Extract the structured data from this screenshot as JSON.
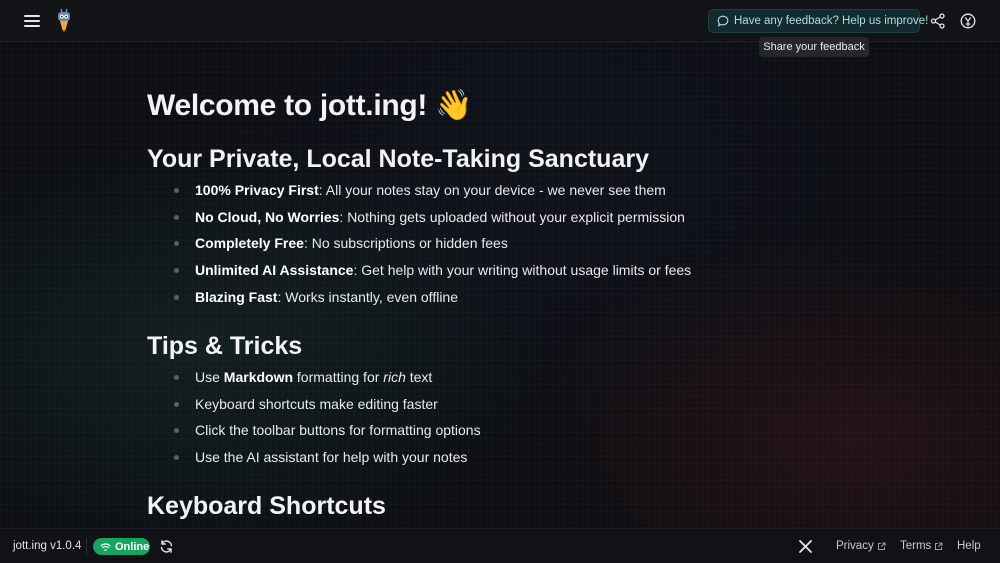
{
  "header": {
    "feedback_label": "Have any feedback? Help us improve!",
    "tooltip": "Share your feedback"
  },
  "main": {
    "title": "Welcome to jott.ing! 👋",
    "sections": [
      {
        "heading": "Your Private, Local Note-Taking Sanctuary",
        "items": [
          {
            "bold": "100% Privacy First",
            "text": ": All your notes stay on your device - we never see them"
          },
          {
            "bold": "No Cloud, No Worries",
            "text": ": Nothing gets uploaded without your explicit permission"
          },
          {
            "bold": "Completely Free",
            "text": ": No subscriptions or hidden fees"
          },
          {
            "bold": "Unlimited AI Assistance",
            "text": ": Get help with your writing without usage limits or fees"
          },
          {
            "bold": "Blazing Fast",
            "text": ": Works instantly, even offline"
          }
        ]
      },
      {
        "heading": "Tips & Tricks",
        "items": [
          {
            "pre": "Use ",
            "bold": "Markdown",
            "mid": " formatting for ",
            "italic": "rich",
            "post": " text"
          },
          {
            "text": "Keyboard shortcuts make editing faster"
          },
          {
            "text": "Click the toolbar buttons for formatting options"
          },
          {
            "text": "Use the AI assistant for help with your notes"
          }
        ]
      },
      {
        "heading": "Keyboard Shortcuts"
      }
    ]
  },
  "footer": {
    "version": "jott.ing v1.0.4",
    "status": "Online",
    "links": [
      "Privacy",
      "Terms",
      "Help"
    ]
  },
  "colors": {
    "accent": "#17a360",
    "feedback_bg": "#132a2e",
    "feedback_text": "#a9dfe0"
  },
  "icons": [
    "menu-icon",
    "logo-icon",
    "chat-bubble-icon",
    "share-icon",
    "language-icon",
    "wifi-icon",
    "refresh-icon",
    "x-icon",
    "external-link-icon"
  ]
}
